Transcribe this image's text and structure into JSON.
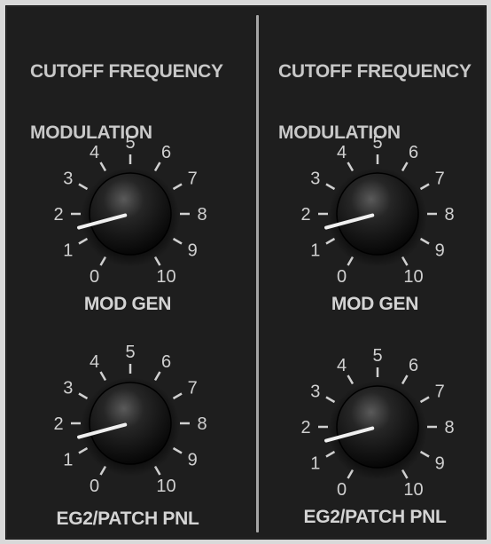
{
  "sections": [
    {
      "title_line1": "CUTOFF FREQUENCY",
      "title_line2": "MODULATION",
      "knobs": [
        {
          "label": "MOD GEN",
          "value": 1.5
        },
        {
          "label": "EG2/PATCH PNL",
          "value": 1.5
        }
      ]
    },
    {
      "title_line1": "CUTOFF FREQUENCY",
      "title_line2": "MODULATION",
      "knobs": [
        {
          "label": "MOD GEN",
          "value": 1.5
        },
        {
          "label": "EG2/PATCH PNL",
          "value": 1.5
        }
      ]
    }
  ],
  "scale": [
    "0",
    "1",
    "2",
    "3",
    "4",
    "5",
    "6",
    "7",
    "8",
    "9",
    "10"
  ],
  "colors": {
    "panel": "#1e1e1e",
    "text": "#d0d0d0",
    "knob": "#101010",
    "pointer": "#f0f0f0",
    "divider": "#a6a6a6"
  }
}
